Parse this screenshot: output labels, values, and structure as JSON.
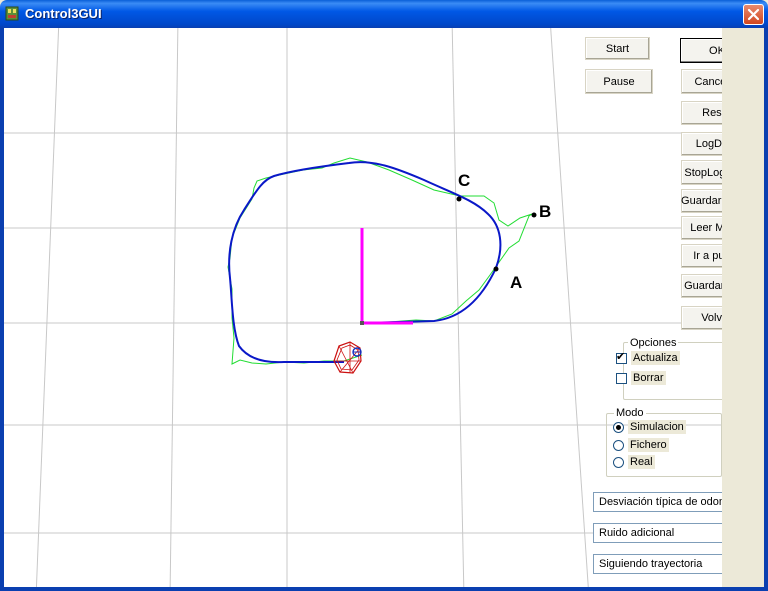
{
  "window": {
    "title": "Control3GUI",
    "icon": "app-icon",
    "close_icon": "close-icon"
  },
  "map": {
    "labels": {
      "a": "A",
      "b": "B",
      "c": "C"
    },
    "colors": {
      "path": "#0a18c8",
      "trajectory": "#22dd33",
      "axes": "#ff00ff",
      "grid": "#c8c8c8",
      "robot": "#cc1111"
    }
  },
  "controls": {
    "start": "Start",
    "pause": "Pause",
    "ok": "OK",
    "cancel": "Cancelar",
    "reset": "Reset",
    "logdata": "LogData",
    "stoplogdata": "StopLogData",
    "guardar_mapa": "Guardar Mapa",
    "leer_mapa": "Leer Mapa",
    "ir_a_punto": "Ir a punto",
    "guardar_tray": "Guardar Tray",
    "volver": "Volver"
  },
  "opciones": {
    "title": "Opciones",
    "actualiza": {
      "label": "Actualiza",
      "checked": true
    },
    "borrar": {
      "label": "Borrar",
      "checked": false
    }
  },
  "modo": {
    "title": "Modo",
    "options": [
      {
        "label": "Simulacion",
        "selected": true
      },
      {
        "label": "Fichero",
        "selected": false
      },
      {
        "label": "Real",
        "selected": false
      }
    ]
  },
  "status": {
    "odometria": "Desviación típica de odometría",
    "ruido": "Ruido adicional",
    "estado": "Siguiendo trayectoria"
  }
}
